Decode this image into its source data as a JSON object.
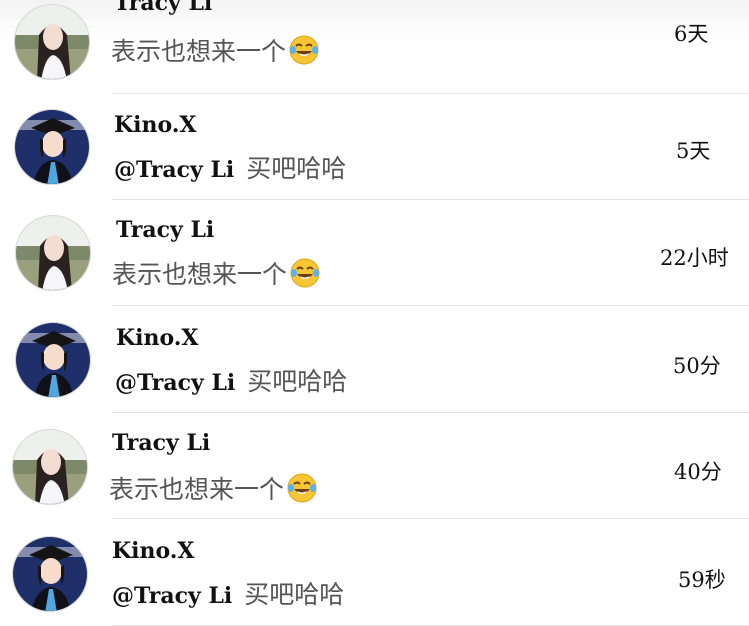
{
  "comments": [
    {
      "name": "Tracy Li",
      "text": "表示也想来一个",
      "emoji": "face-with-tears-of-joy",
      "time": "6天"
    },
    {
      "name": "Kino.X",
      "mention": "@Tracy Li",
      "text": "买吧哈哈",
      "time": "5天"
    },
    {
      "name": "Tracy Li",
      "text": "表示也想来一个",
      "emoji": "face-with-tears-of-joy",
      "time": "22小时"
    },
    {
      "name": "Kino.X",
      "mention": "@Tracy Li",
      "text": "买吧哈哈",
      "time": "50分"
    },
    {
      "name": "Tracy Li",
      "text": "表示也想来一个",
      "emoji": "face-with-tears-of-joy",
      "time": "40分"
    },
    {
      "name": "Kino.X",
      "mention": "@Tracy Li",
      "text": "买吧哈哈",
      "time": "59秒"
    }
  ],
  "colors": {
    "separator": "#e4e4e4",
    "name": "#111111",
    "message": "#555555"
  }
}
